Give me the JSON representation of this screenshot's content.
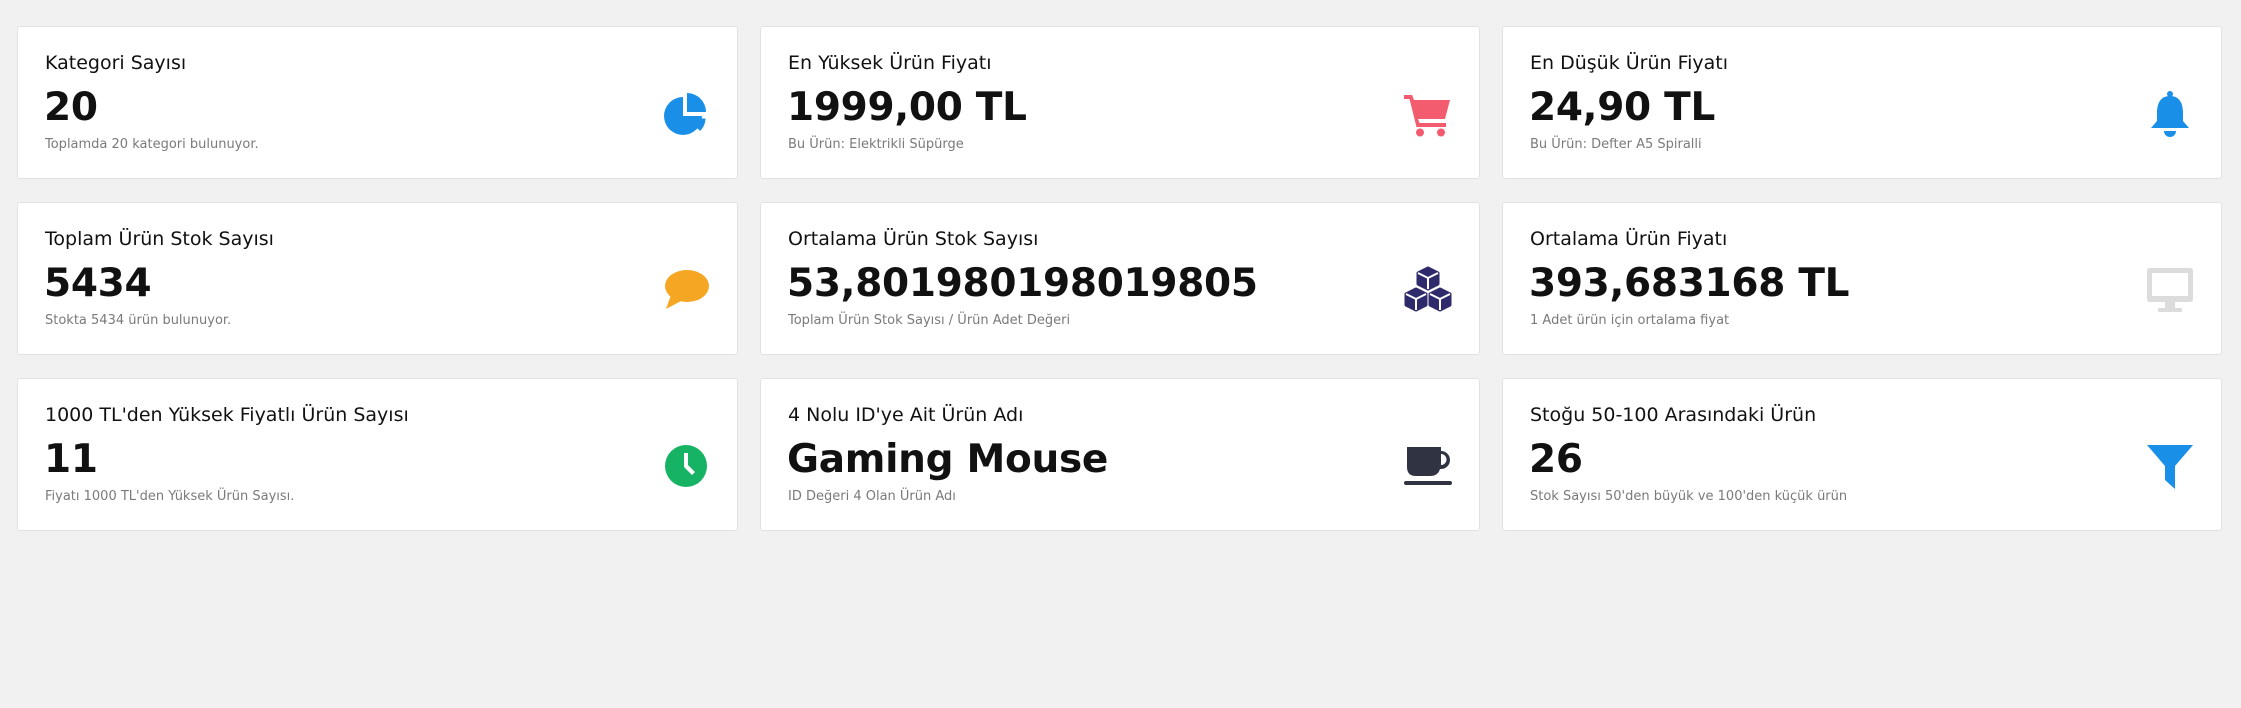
{
  "cards": [
    {
      "title": "Kategori Sayısı",
      "value": "20",
      "subtitle": "Toplamda 20 kategori bulunuyor.",
      "icon": "pie-chart-icon",
      "icon_color": "#1a8fe8"
    },
    {
      "title": "En Yüksek Ürün Fiyatı",
      "value": "1999,00 TL",
      "subtitle": "Bu Ürün: Elektrikli Süpürge",
      "icon": "shopping-cart-icon",
      "icon_color": "#f35b6e"
    },
    {
      "title": "En Düşük Ürün Fiyatı",
      "value": "24,90 TL",
      "subtitle": "Bu Ürün: Defter A5 Spiralli",
      "icon": "bell-icon",
      "icon_color": "#1a8fe8"
    },
    {
      "title": "Toplam Ürün Stok Sayısı",
      "value": "5434",
      "subtitle": "Stokta 5434 ürün bulunuyor.",
      "icon": "comment-icon",
      "icon_color": "#f5a623"
    },
    {
      "title": "Ortalama Ürün Stok Sayısı",
      "value": "53,801980198019805",
      "subtitle": "Toplam Ürün Stok Sayısı / Ürün Adet Değeri",
      "icon": "cubes-icon",
      "icon_color": "#2e2a6b"
    },
    {
      "title": "Ortalama Ürün Fiyatı",
      "value": "393,683168 TL",
      "subtitle": "1 Adet ürün için ortalama fiyat",
      "icon": "desktop-icon",
      "icon_color": "#dcdcdc"
    },
    {
      "title": "1000 TL'den Yüksek Fiyatlı Ürün Sayısı",
      "value": "11",
      "subtitle": "Fiyatı 1000 TL'den Yüksek Ürün Sayısı.",
      "icon": "clock-icon",
      "icon_color": "#17b364"
    },
    {
      "title": "4 Nolu ID'ye Ait Ürün Adı",
      "value": "Gaming Mouse",
      "subtitle": "ID Değeri 4 Olan Ürün Adı",
      "icon": "coffee-cup-icon",
      "icon_color": "#2f3342"
    },
    {
      "title": "Stoğu 50-100 Arasındaki Ürün",
      "value": "26",
      "subtitle": "Stok Sayısı 50'den büyük ve 100'den küçük ürün",
      "icon": "filter-icon",
      "icon_color": "#1a8fe8"
    }
  ]
}
